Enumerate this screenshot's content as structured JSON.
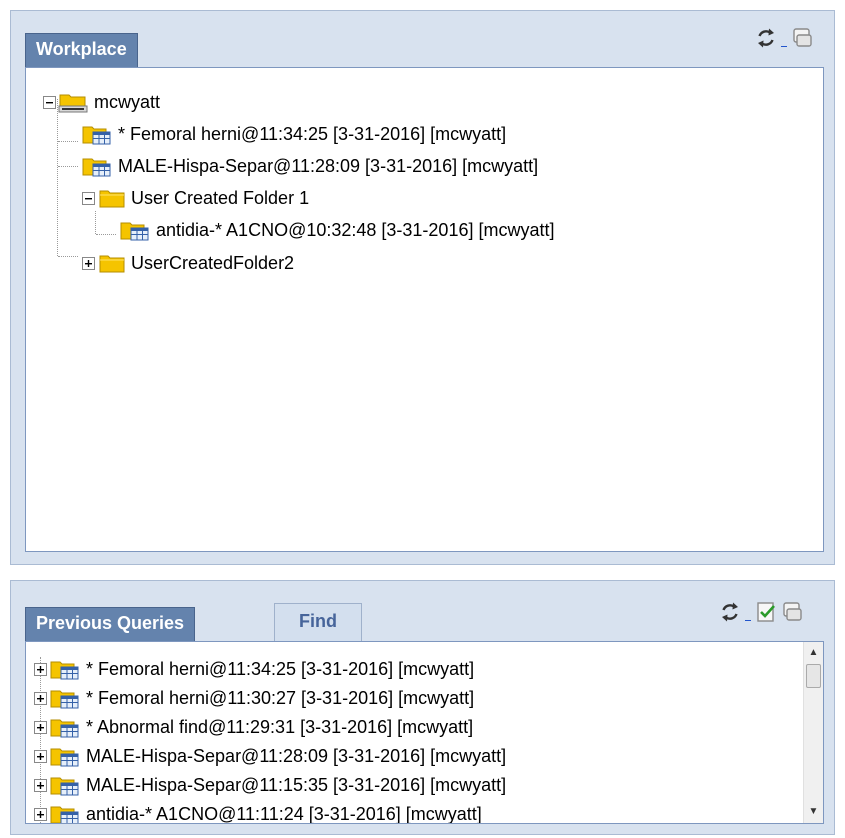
{
  "workplace": {
    "tab_label": "Workplace",
    "root": {
      "label": "mcwyatt",
      "children": [
        {
          "label": "* Femoral herni@11:34:25 [3-31-2016] [mcwyatt]"
        },
        {
          "label": "MALE-Hispa-Separ@11:28:09 [3-31-2016] [mcwyatt]"
        },
        {
          "label": "User Created Folder 1",
          "expanded": true,
          "children": [
            {
              "label": "antidia-* A1CNO@10:32:48 [3-31-2016] [mcwyatt]"
            }
          ]
        },
        {
          "label": "UserCreatedFolder2",
          "expanded": false
        }
      ]
    }
  },
  "previous_queries": {
    "tab_label": "Previous Queries",
    "find_tab_label": "Find",
    "items": [
      {
        "label": "* Femoral herni@11:34:25 [3-31-2016] [mcwyatt]"
      },
      {
        "label": "* Femoral herni@11:30:27 [3-31-2016] [mcwyatt]"
      },
      {
        "label": "* Abnormal find@11:29:31 [3-31-2016] [mcwyatt]"
      },
      {
        "label": "MALE-Hispa-Separ@11:28:09 [3-31-2016] [mcwyatt]"
      },
      {
        "label": "MALE-Hispa-Separ@11:15:35 [3-31-2016] [mcwyatt]"
      },
      {
        "label": "antidia-* A1CNO@11:11:24 [3-31-2016] [mcwyatt]"
      }
    ]
  },
  "icons": {
    "refresh": "refresh-icon",
    "display": "display-icon",
    "check_document": "check-document-icon",
    "expand": "plus-box-icon",
    "collapse": "minus-box-icon",
    "folder": "folder-icon",
    "query": "query-folder-icon"
  },
  "colors": {
    "accent": "#6483ad",
    "panel_bg": "#d8e2ef",
    "folder": "#f5c400"
  }
}
